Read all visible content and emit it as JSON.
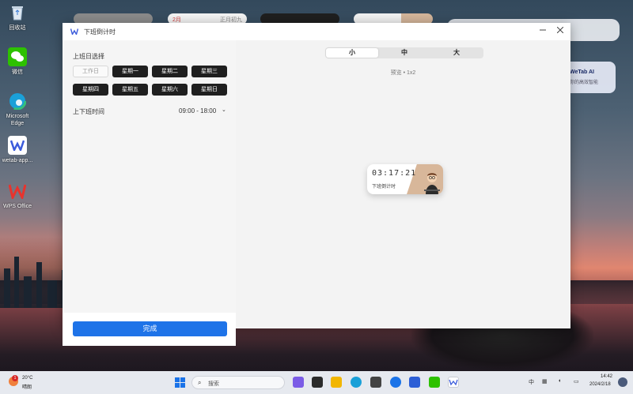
{
  "desktop": {
    "icons": [
      {
        "label": "回收站",
        "icon": "recycle-bin-icon"
      },
      {
        "label": "微信",
        "icon": "wechat-icon"
      },
      {
        "label": "Microsoft Edge",
        "icon": "edge-icon"
      },
      {
        "label": "wetab-app...",
        "icon": "wetab-icon"
      },
      {
        "label": "WPS Office",
        "icon": "wps-icon"
      }
    ],
    "widgets": {
      "calendar_month": "2月",
      "calendar_note": "正月初九",
      "ai_title": "WeTab AI",
      "ai_subtitle": "你的高效智能"
    }
  },
  "window": {
    "title": "下班倒计时",
    "accent": "#1e73e8",
    "left": {
      "workday_section_label": "上班日选择",
      "days": [
        {
          "label": "工作日",
          "selected": false
        },
        {
          "label": "星期一",
          "selected": true
        },
        {
          "label": "星期二",
          "selected": true
        },
        {
          "label": "星期三",
          "selected": true
        },
        {
          "label": "星期四",
          "selected": true
        },
        {
          "label": "星期五",
          "selected": true
        },
        {
          "label": "星期六",
          "selected": true
        },
        {
          "label": "星期日",
          "selected": true
        }
      ],
      "time_label": "上下班时间",
      "time_value": "09:00 - 18:00",
      "done_label": "完成"
    },
    "right": {
      "size_tabs": [
        {
          "label": "小",
          "active": true
        },
        {
          "label": "中",
          "active": false
        },
        {
          "label": "大",
          "active": false
        }
      ],
      "preview_text": "预览 • 1x2",
      "card": {
        "time": "03:17:21",
        "label": "下班倒计时"
      }
    }
  },
  "taskbar": {
    "weather_badge": "1",
    "weather_temp": "20°C",
    "weather_condition": "晴朗",
    "search_placeholder": "搜索",
    "tray_text": "中",
    "clock_time": "14:42",
    "clock_date": "2024/2/18"
  }
}
